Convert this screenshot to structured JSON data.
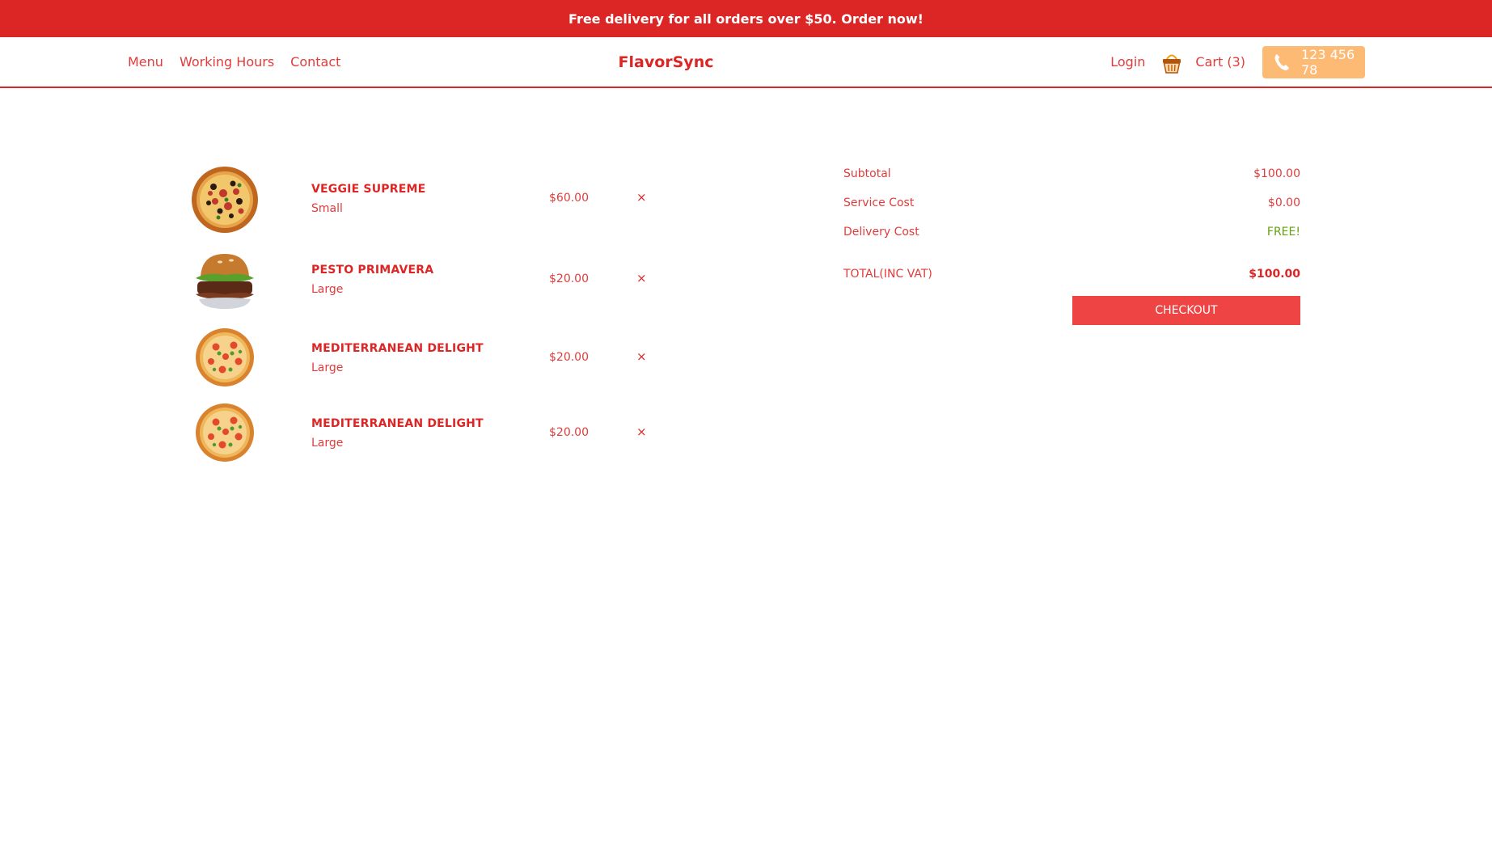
{
  "banner": {
    "text": "Free delivery for all orders over $50. Order now!"
  },
  "nav": {
    "links": [
      "Menu",
      "Working Hours",
      "Contact"
    ],
    "brand": "FlavorSync",
    "login": "Login",
    "basket_icon": "basket-icon",
    "cart_label": "Cart (3)",
    "phone_icon": "phone-icon",
    "phone": "123 456 78"
  },
  "cart": {
    "items": [
      {
        "name": "VEGGIE SUPREME",
        "size": "Small",
        "price": "$60.00",
        "remove": "×",
        "image": "pizza-image"
      },
      {
        "name": "PESTO PRIMAVERA",
        "size": "Large",
        "price": "$20.00",
        "remove": "×",
        "image": "burger-image"
      },
      {
        "name": "MEDITERRANEAN DELIGHT",
        "size": "Large",
        "price": "$20.00",
        "remove": "×",
        "image": "pizza-image"
      },
      {
        "name": "MEDITERRANEAN DELIGHT",
        "size": "Large",
        "price": "$20.00",
        "remove": "×",
        "image": "pizza-image"
      }
    ]
  },
  "summary": {
    "subtotal_label": "Subtotal",
    "subtotal": "$100.00",
    "service_label": "Service Cost",
    "service": "$0.00",
    "delivery_label": "Delivery Cost",
    "delivery": "FREE!",
    "total_label": "TOTAL(INC VAT)",
    "total": "$100.00",
    "checkout": "CHECKOUT"
  },
  "colors": {
    "brand_red": "#dc2626",
    "link_red": "#e23b3b",
    "phone_button": "#fdba74",
    "free_green": "#65a30d"
  }
}
